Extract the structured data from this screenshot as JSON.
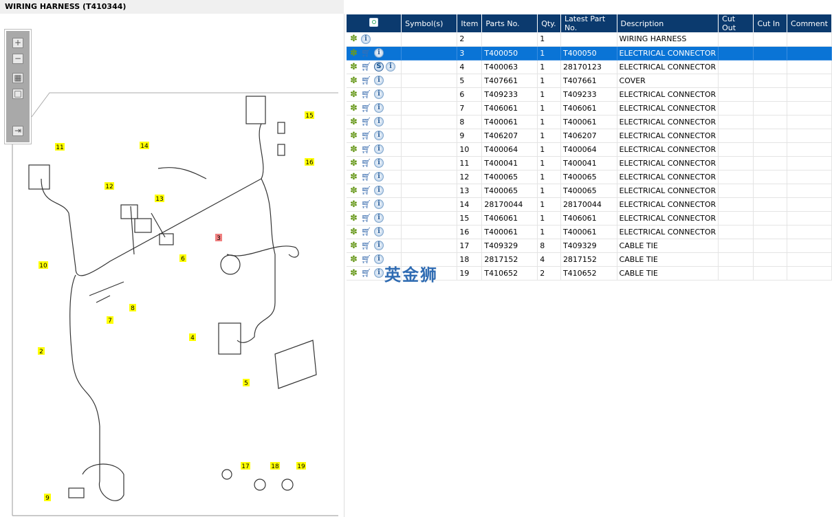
{
  "title": "WIRING HARNESS (T410344)",
  "toolbar": {
    "zoom_in": "+",
    "zoom_out": "−",
    "fit": "▦",
    "actual": "□",
    "toggle": "⇥"
  },
  "diagram_labels": [
    {
      "n": "11"
    },
    {
      "n": "14"
    },
    {
      "n": "15"
    },
    {
      "n": "16"
    },
    {
      "n": "12"
    },
    {
      "n": "13"
    },
    {
      "n": "3",
      "hl": true
    },
    {
      "n": "6"
    },
    {
      "n": "10"
    },
    {
      "n": "8"
    },
    {
      "n": "7"
    },
    {
      "n": "2"
    },
    {
      "n": "4"
    },
    {
      "n": "5"
    },
    {
      "n": "17"
    },
    {
      "n": "18"
    },
    {
      "n": "19"
    },
    {
      "n": "9"
    }
  ],
  "table": {
    "headers": [
      "",
      "Symbol(s)",
      "Item",
      "Parts No.",
      "Qty.",
      "Latest Part No.",
      "Description",
      "Cut Out",
      "Cut In",
      "Comment"
    ],
    "rows": [
      {
        "icons": [
          "gear",
          "info"
        ],
        "item": "2",
        "part": "",
        "qty": "1",
        "latest": "",
        "desc": "WIRING HARNESS"
      },
      {
        "icons": [
          "gear",
          "cart",
          "info"
        ],
        "item": "3",
        "part": "T400050",
        "qty": "1",
        "latest": "T400050",
        "desc": "ELECTRICAL CONNECTOR",
        "selected": true
      },
      {
        "icons": [
          "gear",
          "cart",
          "s",
          "info"
        ],
        "item": "4",
        "part": "T400063",
        "qty": "1",
        "latest": "28170123",
        "desc": "ELECTRICAL CONNECTOR"
      },
      {
        "icons": [
          "gear",
          "cart",
          "info"
        ],
        "item": "5",
        "part": "T407661",
        "qty": "1",
        "latest": "T407661",
        "desc": "COVER"
      },
      {
        "icons": [
          "gear",
          "cart",
          "info"
        ],
        "item": "6",
        "part": "T409233",
        "qty": "1",
        "latest": "T409233",
        "desc": "ELECTRICAL CONNECTOR"
      },
      {
        "icons": [
          "gear",
          "cart",
          "info"
        ],
        "item": "7",
        "part": "T406061",
        "qty": "1",
        "latest": "T406061",
        "desc": "ELECTRICAL CONNECTOR"
      },
      {
        "icons": [
          "gear",
          "cart",
          "info"
        ],
        "item": "8",
        "part": "T400061",
        "qty": "1",
        "latest": "T400061",
        "desc": "ELECTRICAL CONNECTOR"
      },
      {
        "icons": [
          "gear",
          "cart",
          "info"
        ],
        "item": "9",
        "part": "T406207",
        "qty": "1",
        "latest": "T406207",
        "desc": "ELECTRICAL CONNECTOR"
      },
      {
        "icons": [
          "gear",
          "cart",
          "info"
        ],
        "item": "10",
        "part": "T400064",
        "qty": "1",
        "latest": "T400064",
        "desc": "ELECTRICAL CONNECTOR"
      },
      {
        "icons": [
          "gear",
          "cart",
          "info"
        ],
        "item": "11",
        "part": "T400041",
        "qty": "1",
        "latest": "T400041",
        "desc": "ELECTRICAL CONNECTOR"
      },
      {
        "icons": [
          "gear",
          "cart",
          "info"
        ],
        "item": "12",
        "part": "T400065",
        "qty": "1",
        "latest": "T400065",
        "desc": "ELECTRICAL CONNECTOR"
      },
      {
        "icons": [
          "gear",
          "cart",
          "info"
        ],
        "item": "13",
        "part": "T400065",
        "qty": "1",
        "latest": "T400065",
        "desc": "ELECTRICAL CONNECTOR"
      },
      {
        "icons": [
          "gear",
          "cart",
          "info"
        ],
        "item": "14",
        "part": "28170044",
        "qty": "1",
        "latest": "28170044",
        "desc": "ELECTRICAL CONNECTOR"
      },
      {
        "icons": [
          "gear",
          "cart",
          "info"
        ],
        "item": "15",
        "part": "T406061",
        "qty": "1",
        "latest": "T406061",
        "desc": "ELECTRICAL CONNECTOR"
      },
      {
        "icons": [
          "gear",
          "cart",
          "info"
        ],
        "item": "16",
        "part": "T400061",
        "qty": "1",
        "latest": "T400061",
        "desc": "ELECTRICAL CONNECTOR"
      },
      {
        "icons": [
          "gear",
          "cart",
          "info"
        ],
        "item": "17",
        "part": "T409329",
        "qty": "8",
        "latest": "T409329",
        "desc": "CABLE TIE"
      },
      {
        "icons": [
          "gear",
          "cart",
          "info"
        ],
        "item": "18",
        "part": "2817152",
        "qty": "4",
        "latest": "2817152",
        "desc": "CABLE TIE"
      },
      {
        "icons": [
          "gear",
          "cart",
          "info"
        ],
        "item": "19",
        "part": "T410652",
        "qty": "2",
        "latest": "T410652",
        "desc": "CABLE TIE"
      }
    ]
  },
  "watermark": "英金狮",
  "colors": {
    "header": "#0b3a6e",
    "selected": "#0a74d6",
    "label": "#ffff00",
    "label_hl": "#f08080"
  }
}
